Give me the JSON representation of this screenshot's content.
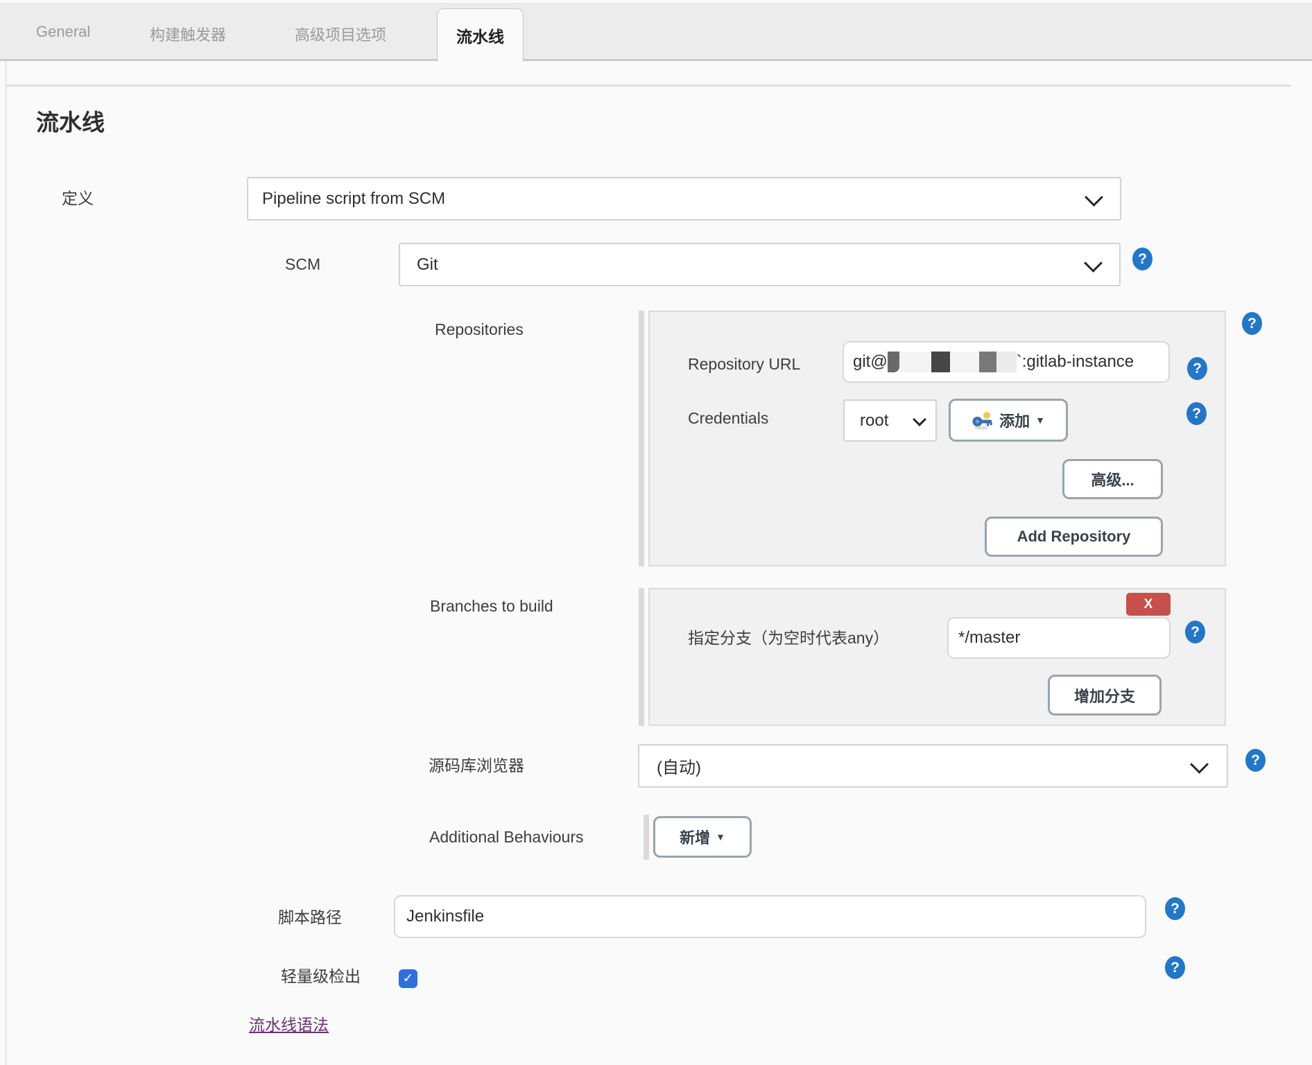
{
  "tabs": [
    {
      "label": "General",
      "active": false
    },
    {
      "label": "构建触发器",
      "active": false
    },
    {
      "label": "高级项目选项",
      "active": false
    },
    {
      "label": "流水线",
      "active": true
    }
  ],
  "page": {
    "title": "流水线"
  },
  "icons": {
    "help": "?",
    "caret_down": "▼",
    "check": "✓"
  },
  "definition": {
    "label": "定义",
    "value": "Pipeline script from SCM"
  },
  "scm": {
    "label": "SCM",
    "value": "Git"
  },
  "repositories": {
    "section_label": "Repositories",
    "repository_url": {
      "label": "Repository URL",
      "value_prefix": "git@",
      "value_suffix": "`:gitlab-instance"
    },
    "credentials": {
      "label": "Credentials",
      "selected": "root",
      "add_button": "添加"
    },
    "advanced_button": "高级...",
    "add_repository_button": "Add Repository"
  },
  "branches": {
    "section_label": "Branches to build",
    "delete_button": "X",
    "branch_spec": {
      "label": "指定分支（为空时代表any）",
      "value": "*/master"
    },
    "add_branch_button": "增加分支"
  },
  "repository_browser": {
    "label": "源码库浏览器",
    "value": "(自动)"
  },
  "additional_behaviours": {
    "label": "Additional Behaviours",
    "add_button": "新增"
  },
  "script_path": {
    "label": "脚本路径",
    "value": "Jenkinsfile"
  },
  "lightweight_checkout": {
    "label": "轻量级检出",
    "checked": true
  },
  "pipeline_syntax_link": "流水线语法",
  "colors": {
    "help_icon": "#2277c8",
    "checkbox_blue": "#2f6fde",
    "delete_red": "#c8504a",
    "link_purple": "#6b2f71"
  }
}
